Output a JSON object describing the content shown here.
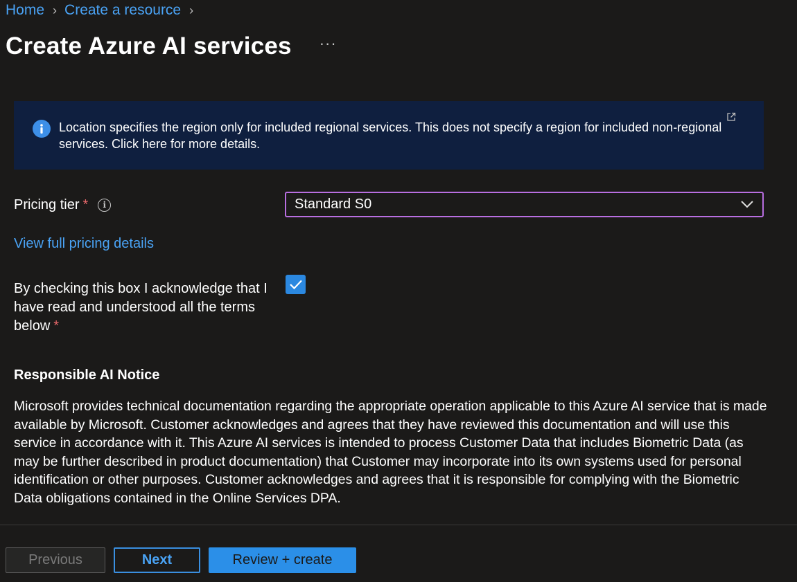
{
  "breadcrumb": {
    "items": [
      "Home",
      "Create a resource"
    ]
  },
  "header": {
    "title": "Create Azure AI services",
    "more": "···"
  },
  "info_banner": {
    "text": "Location specifies the region only for included regional services. This does not specify a region for included non-regional services. Click here for more details."
  },
  "form": {
    "pricing_tier": {
      "label": "Pricing tier",
      "required_mark": "*",
      "value": "Standard S0"
    },
    "pricing_link": "View full pricing details",
    "acknowledge": {
      "label": "By checking this box I acknowledge that I have read and understood all the terms below",
      "required_mark": "*",
      "checked": true
    }
  },
  "notice": {
    "heading": "Responsible AI Notice",
    "body": "Microsoft provides technical documentation regarding the appropriate operation applicable to this Azure AI service that is made available by Microsoft. Customer acknowledges and agrees that they have reviewed this documentation and will use this service in accordance with it. This Azure AI services is intended to process Customer Data that includes Biometric Data (as may be further described in product documentation) that Customer may incorporate into its own systems used for personal identification or other purposes. Customer acknowledges and agrees that it is responsible for complying with the Biometric Data obligations contained in the Online Services DPA."
  },
  "footer": {
    "previous": "Previous",
    "next": "Next",
    "review": "Review + create"
  },
  "colors": {
    "background": "#1b1a19",
    "link": "#4aa3f5",
    "banner": "#0f1f3f",
    "accent": "#2b8fe8",
    "select_border": "#b86ee0",
    "required": "#e8686b"
  }
}
